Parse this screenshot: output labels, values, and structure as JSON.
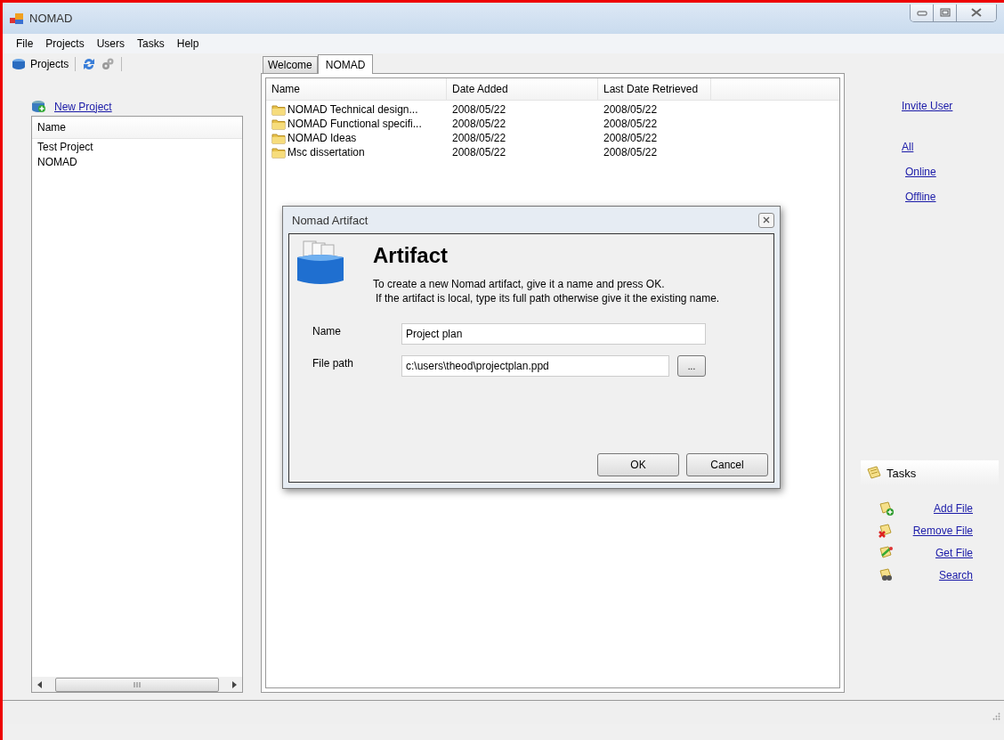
{
  "window": {
    "title": "NOMAD"
  },
  "menu": [
    "File",
    "Projects",
    "Users",
    "Tasks",
    "Help"
  ],
  "projects_panel": {
    "toolbar_label": "Projects",
    "new_project": "New Project",
    "column": "Name",
    "items": [
      "Test Project",
      "NOMAD"
    ]
  },
  "tabs": [
    {
      "label": "Welcome",
      "selected": false
    },
    {
      "label": "NOMAD",
      "selected": true
    }
  ],
  "files_table": {
    "columns": [
      "Name",
      "Date Added",
      "Last Date Retrieved"
    ],
    "rows": [
      [
        "NOMAD Technical design...",
        "2008/05/22",
        "2008/05/22"
      ],
      [
        "NOMAD Functional specifi...",
        "2008/05/22",
        "2008/05/22"
      ],
      [
        "NOMAD Ideas",
        "2008/05/22",
        "2008/05/22"
      ],
      [
        "Msc dissertation",
        "2008/05/22",
        "2008/05/22"
      ]
    ]
  },
  "dialog": {
    "title": "Nomad Artifact",
    "heading": "Artifact",
    "description": [
      "To create a new Nomad artifact, give it a name and press OK.",
      "If the artifact is local, type its full path otherwise give it the existing name."
    ],
    "fields": [
      {
        "label": "Name",
        "value": "Project plan"
      },
      {
        "label": "File path",
        "value": "c:\\users\\theod\\projectplan.ppd",
        "browse": "..."
      }
    ],
    "buttons": [
      "OK",
      "Cancel"
    ]
  },
  "users_panel": {
    "invite": "Invite User",
    "filters": [
      "All",
      "Online",
      "Offline"
    ]
  },
  "tasks_panel": {
    "title": "Tasks",
    "items": [
      {
        "kind": "add",
        "label": "Add File"
      },
      {
        "kind": "remove",
        "label": "Remove File"
      },
      {
        "kind": "get",
        "label": "Get File"
      },
      {
        "kind": "search",
        "label": "Search"
      }
    ]
  }
}
